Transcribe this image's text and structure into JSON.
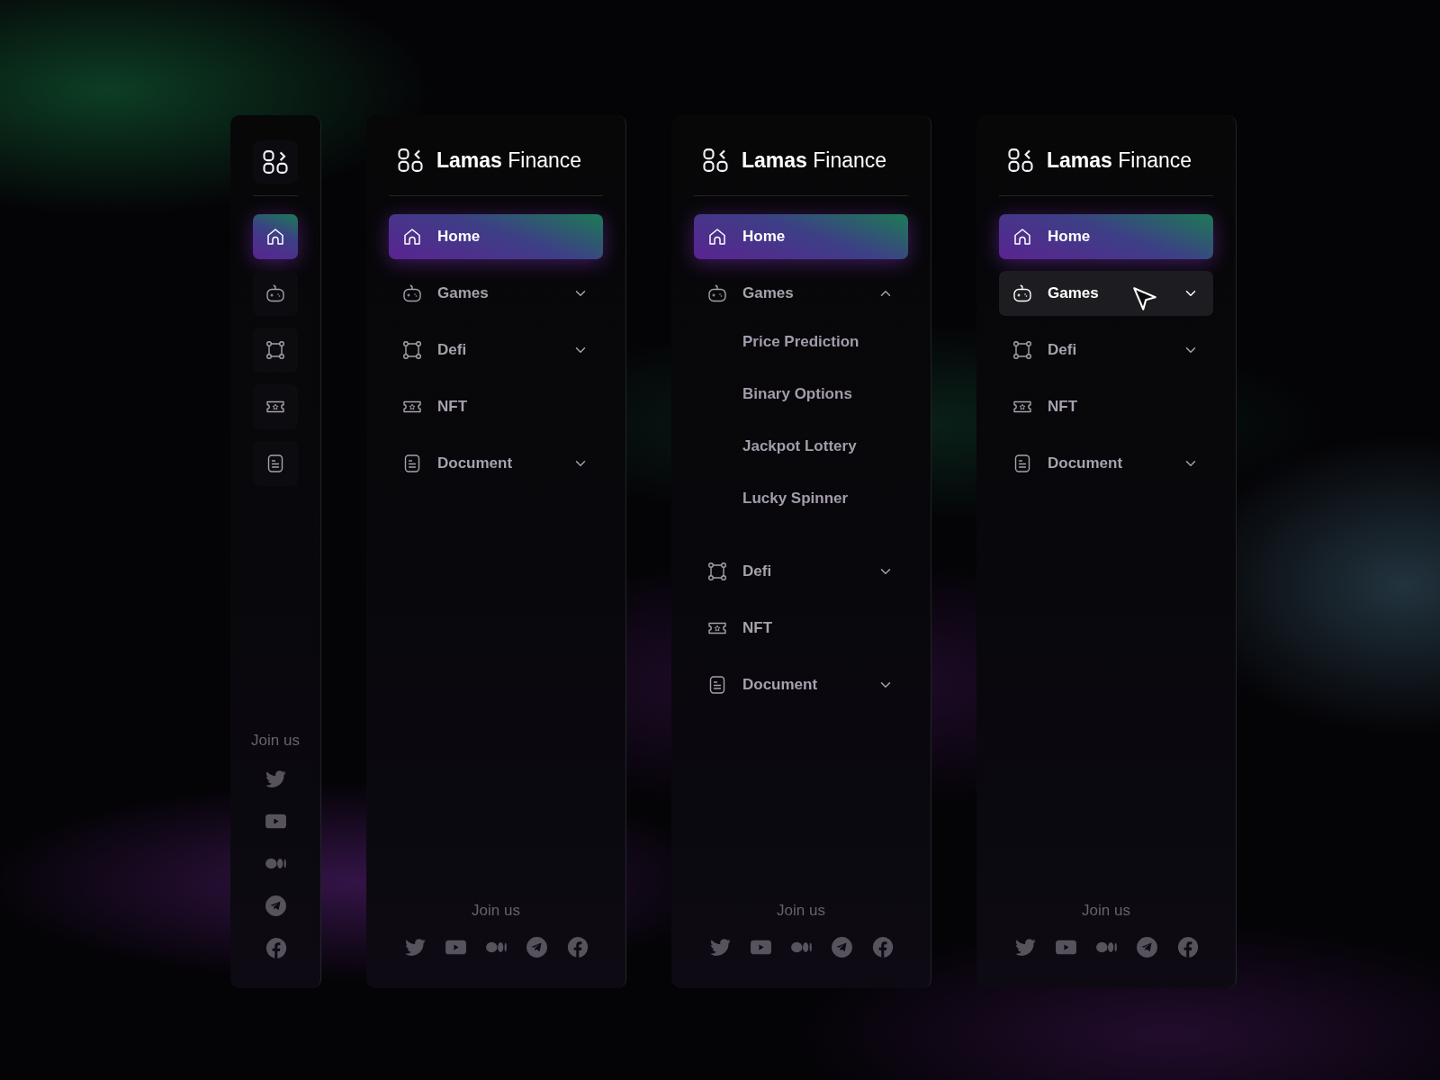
{
  "panels": [
    {
      "kind": "collapsed",
      "nav": [
        {
          "selected": true
        },
        {
          "selected": false
        },
        {
          "selected": false
        },
        {
          "selected": false
        },
        {
          "selected": false
        }
      ],
      "join_label": "Join us"
    },
    {
      "kind": "expanded",
      "brand_bold": "Lamas",
      "brand_light": "Finance",
      "nav": [
        {
          "label": "Home",
          "kind": "link",
          "selected": true,
          "hovered": false
        },
        {
          "label": "Games",
          "kind": "group",
          "expanded": false,
          "selected": false,
          "hovered": false
        },
        {
          "label": "Defi",
          "kind": "group",
          "expanded": false,
          "selected": false,
          "hovered": false
        },
        {
          "label": "NFT",
          "kind": "link",
          "selected": false,
          "hovered": false
        },
        {
          "label": "Document",
          "kind": "group",
          "expanded": false,
          "selected": false,
          "hovered": false
        }
      ],
      "join_label": "Join us"
    },
    {
      "kind": "expanded",
      "brand_bold": "Lamas",
      "brand_light": "Finance",
      "nav": [
        {
          "label": "Home",
          "kind": "link",
          "selected": true,
          "hovered": false
        },
        {
          "label": "Games",
          "kind": "group",
          "expanded": true,
          "selected": false,
          "hovered": false,
          "children": [
            "Price Prediction",
            "Binary Options",
            "Jackpot Lottery",
            "Lucky Spinner"
          ]
        },
        {
          "label": "Defi",
          "kind": "group",
          "expanded": false,
          "selected": false,
          "hovered": false
        },
        {
          "label": "NFT",
          "kind": "link",
          "selected": false,
          "hovered": false
        },
        {
          "label": "Document",
          "kind": "group",
          "expanded": false,
          "selected": false,
          "hovered": false
        }
      ],
      "join_label": "Join us"
    },
    {
      "kind": "expanded",
      "brand_bold": "Lamas",
      "brand_light": "Finance",
      "nav": [
        {
          "label": "Home",
          "kind": "link",
          "selected": true,
          "hovered": false
        },
        {
          "label": "Games",
          "kind": "group",
          "expanded": false,
          "selected": false,
          "hovered": true
        },
        {
          "label": "Defi",
          "kind": "group",
          "expanded": false,
          "selected": false,
          "hovered": false
        },
        {
          "label": "NFT",
          "kind": "link",
          "selected": false,
          "hovered": false
        },
        {
          "label": "Document",
          "kind": "group",
          "expanded": false,
          "selected": false,
          "hovered": false
        }
      ],
      "join_label": "Join us"
    }
  ]
}
